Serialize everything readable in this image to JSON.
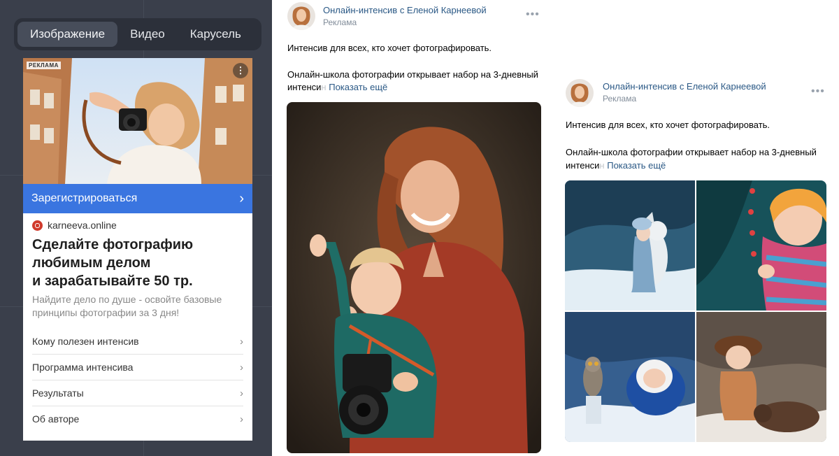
{
  "yandex_preview": {
    "tabs": [
      {
        "label": "Изображение",
        "active": true
      },
      {
        "label": "Видео",
        "active": false
      },
      {
        "label": "Карусель",
        "active": false
      }
    ],
    "ad": {
      "badge": "РЕКЛАМА",
      "menu_icon": "⋮",
      "cta_label": "Зарегистрироваться",
      "domain": "karneeva.online",
      "headline_lines": [
        "Сделайте фотографию",
        "любимым делом",
        "и зарабатывайте 50 тр."
      ],
      "description_lines": [
        "Найдите дело по душе - освойте базовые",
        "принципы фотографии за 3 дня!"
      ],
      "links": [
        "Кому полезен интенсив",
        "Программа интенсива",
        "Результаты",
        "Об авторе"
      ]
    }
  },
  "posts": [
    {
      "author": "Онлайн-интенсив с Еленой Карнеевой",
      "sponsored": "Реклама",
      "more": "•••",
      "text_line1": "Интенсив для всех, кто хочет фотографировать.",
      "text_line2": "Онлайн-школа фотографии открывает набор на 3-дневный",
      "text_line3_prefix": "интенси",
      "show_more": "Показать ещё"
    },
    {
      "author": "Онлайн-интенсив с Еленой Карнеевой",
      "sponsored": "Реклама",
      "more": "•••",
      "text_line1": "Интенсив для всех, кто хочет фотографировать.",
      "text_line2": "Онлайн-школа фотографии открывает набор на 3-дневный",
      "text_line3_prefix": "интенси",
      "show_more": "Показать ещё"
    }
  ],
  "colors": {
    "panel_bg": "#3a3f4b",
    "cta_blue": "#3a75e0",
    "vk_link": "#2a5885"
  }
}
